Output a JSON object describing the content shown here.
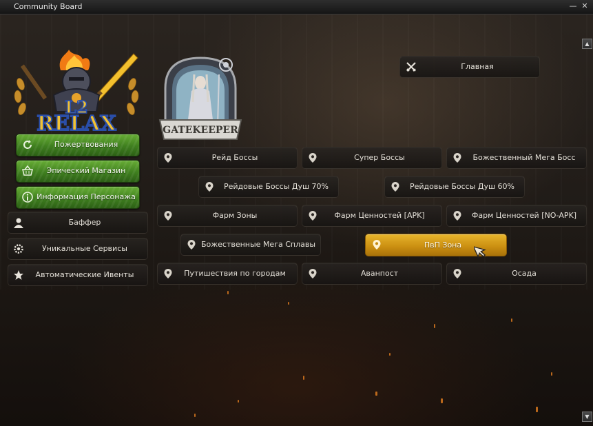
{
  "window": {
    "title": "Community Board"
  },
  "logo": {
    "number": "L2",
    "name": "RELAX"
  },
  "gatekeeper": {
    "label": "GATEKEEPER"
  },
  "sidebar": {
    "green_items": [
      {
        "label": "Пожертвования",
        "icon": "refresh-icon"
      },
      {
        "label": "Эпический Магазин",
        "icon": "basket-icon"
      },
      {
        "label": "Информация Персонажа",
        "icon": "info-icon"
      }
    ],
    "dark_items": [
      {
        "label": "Баффер",
        "icon": "person-icon"
      },
      {
        "label": "Уникальные Сервисы",
        "icon": "gear-icon"
      },
      {
        "label": "Автоматические Ивенты",
        "icon": "star-icon"
      }
    ]
  },
  "main": {
    "home": {
      "label": "Главная",
      "icon": "crossed-swords-icon"
    },
    "locations": [
      "Рейд Боссы",
      "Супер Боссы",
      "Божественный Мега Босс",
      "Рейдовые Боссы Душ 70%",
      "Рейдовые Боссы Душ 60%",
      "Фарм Зоны",
      "Фарм Ценностей [APK]",
      "Фарм Ценностей [NO-APK]",
      "Божественные Мега Сплавы",
      "ПвП Зона",
      "Путишествия по городам",
      "Аванпост",
      "Осада"
    ],
    "active_location": "ПвП Зона"
  },
  "colors": {
    "green": "#4f9226",
    "gold": "#d9a01e",
    "dark": "#201c19"
  }
}
